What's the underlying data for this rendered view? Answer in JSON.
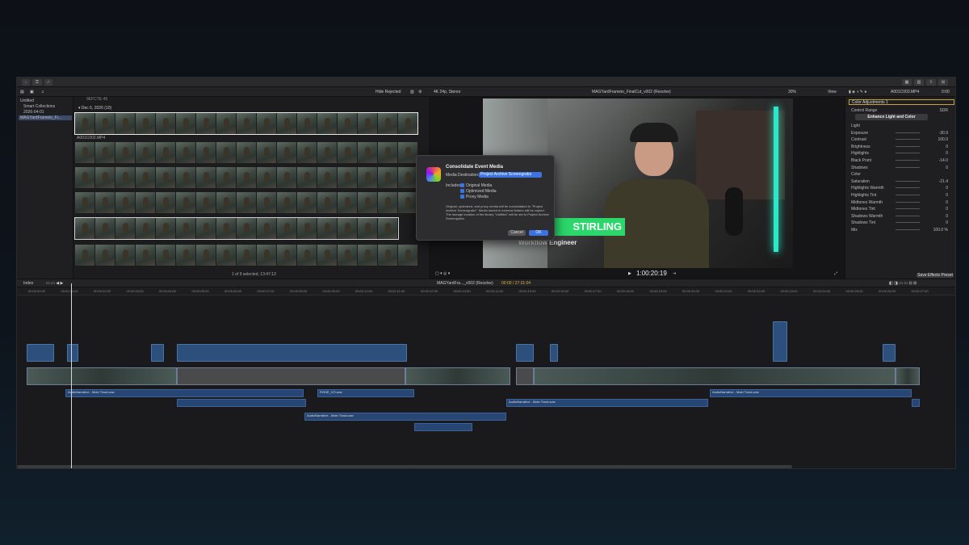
{
  "toolbar": {
    "hide_rejected": "Hide Rejected",
    "format": "4K 24p, Stereo",
    "project_title": "MAGYardFrameio_FinalCut_v002 (Resolve)",
    "zoom": "30%",
    "view": "View",
    "clip_name": "A001C003.MP4",
    "duration": "0:00"
  },
  "sidebar": {
    "items": [
      "Untitled",
      "Smart Collections",
      "2026-04-01",
      "MAGYardFrameio_Fi..."
    ]
  },
  "browser": {
    "top_clip": "9EFCTE 45",
    "date_header": "Dec 6, 2026",
    "date_count": "(10)",
    "clip_label": "A001C002.MP4",
    "status": "1 of 9 selected, 13:47:13"
  },
  "viewer": {
    "lower_third_name": "STIRLING",
    "lower_third_title": "Workflow Engineer",
    "timecode": "1:00:20:19"
  },
  "dialog": {
    "title": "Consolidate Event Media",
    "dest_label": "Media Destination:",
    "dest_value": "Project Archive Screengrabs",
    "includes_label": "Includes:",
    "options": [
      "Original Media",
      "Optimized Media",
      "Proxy Media"
    ],
    "description": "Original, optimized, and proxy media will be consolidated to \"Project Archive Screengrabs\". Media stored in external folders will be copied. The storage location of the library \"Untitled\" will be set to Project Archive Screengrabs.",
    "cancel": "Cancel",
    "ok": "OK"
  },
  "inspector": {
    "effect_name": "Color Adjustments 1",
    "control_range_label": "Control Range",
    "control_range_value": "SDR",
    "enhance_button": "Enhance Light and Color",
    "rows": [
      {
        "label": "Light",
        "value": ""
      },
      {
        "label": "Exposure",
        "value": "-30.9"
      },
      {
        "label": "Contrast",
        "value": "100.0"
      },
      {
        "label": "Brightness",
        "value": "0"
      },
      {
        "label": "Highlights",
        "value": "0"
      },
      {
        "label": "Black Point",
        "value": "-14.0"
      },
      {
        "label": "Shadows",
        "value": "0"
      },
      {
        "label": "Color",
        "value": ""
      },
      {
        "label": "Saturation",
        "value": "-21.4"
      },
      {
        "label": "Highlights Warmth",
        "value": "0"
      },
      {
        "label": "Highlights Tint",
        "value": "0"
      },
      {
        "label": "Midtones Warmth",
        "value": "0"
      },
      {
        "label": "Midtones Tint",
        "value": "0"
      },
      {
        "label": "Shadows Warmth",
        "value": "0"
      },
      {
        "label": "Shadows Tint",
        "value": "0"
      },
      {
        "label": "Mix",
        "value": "100.0 %"
      }
    ],
    "save_preset": "Save Effects Preset"
  },
  "timeline": {
    "index_label": "Index",
    "project_label": "MAGYardFra..._v002 (Resolve)",
    "position": "00:00 / 27:31:04",
    "ruler_marks": [
      "00:00:00:00",
      "00:00:01:00",
      "00:00:02:00",
      "00:00:03:00",
      "00:00:04:00",
      "00:00:05:00",
      "00:00:06:00",
      "00:00:07:00",
      "00:00:08:00",
      "00:00:09:00",
      "00:00:10:00",
      "00:00:11:00",
      "00:00:12:00",
      "00:00:13:00",
      "00:00:14:00",
      "00:00:15:00",
      "00:00:16:00",
      "00:00:17:00",
      "00:00:18:00",
      "00:00:19:00",
      "00:00:20:00",
      "00:00:21:00",
      "00:00:22:00",
      "00:00:23:00",
      "00:00:24:00",
      "00:00:25:00",
      "00:00:26:00",
      "00:00:27:00"
    ],
    "audio_clip_labels": [
      "AudioNarrative - Main Track.wav",
      "AudioNarrative - Main Track.wav",
      "RODE_VO.wav",
      "AudioNarrative - Main Track.wav",
      "AudioNarrative - Main Track.wav"
    ]
  },
  "colors": {
    "accent": "#3b73e0",
    "lower_third": "#2bd66a",
    "clip_blue": "#2d4f7c"
  }
}
